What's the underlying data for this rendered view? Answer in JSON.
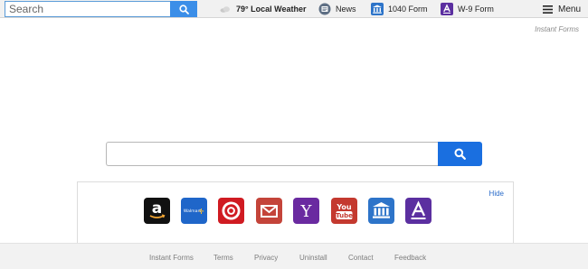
{
  "toolbar": {
    "search_placeholder": "Search",
    "weather_label": "79° Local Weather",
    "news_label": "News",
    "form1040_label": "1040 Form",
    "w9_label": "W-9 Form",
    "menu_label": "Menu",
    "icons": {
      "search": "search-icon",
      "weather": "cloud-icon",
      "news": "news-icon",
      "form1040": "bank-icon",
      "w9": "form-a-icon",
      "menu": "hamburger-icon"
    }
  },
  "brand": "Instant Forms",
  "main_search": {
    "placeholder": "",
    "button_icon": "search-icon"
  },
  "panel": {
    "hide_label": "Hide",
    "tiles": [
      {
        "name": "amazon",
        "color": "#111111",
        "glyph": "a"
      },
      {
        "name": "walmart",
        "color": "#1f66c9",
        "glyph": "Walmart"
      },
      {
        "name": "target",
        "color": "#d01b22",
        "glyph": ""
      },
      {
        "name": "gmail",
        "color": "#c4443a",
        "glyph": ""
      },
      {
        "name": "yahoo",
        "color": "#6a2aa0",
        "glyph": "Y"
      },
      {
        "name": "youtube",
        "color": "#c4392f",
        "glyph": "You Tube"
      },
      {
        "name": "1040-form",
        "color": "#2d74c9",
        "glyph": ""
      },
      {
        "name": "w9-form",
        "color": "#5b2fa0",
        "glyph": "A"
      }
    ]
  },
  "footer": {
    "links": [
      "Instant Forms",
      "Terms",
      "Privacy",
      "Uninstall",
      "Contact",
      "Feedback"
    ]
  }
}
